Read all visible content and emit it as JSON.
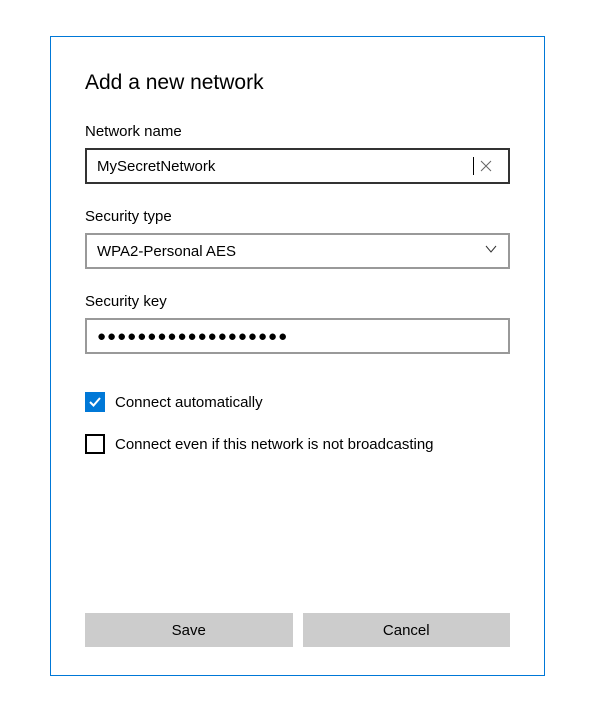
{
  "title": "Add a new network",
  "fields": {
    "network_name": {
      "label": "Network name",
      "value": "MySecretNetwork"
    },
    "security_type": {
      "label": "Security type",
      "value": "WPA2-Personal AES"
    },
    "security_key": {
      "label": "Security key",
      "value_masked": "●●●●●●●●●●●●●●●●●●●"
    }
  },
  "checkboxes": {
    "connect_auto": {
      "label": "Connect automatically",
      "checked": true
    },
    "connect_hidden": {
      "label": "Connect even if this network is not broadcasting",
      "checked": false
    }
  },
  "buttons": {
    "save": "Save",
    "cancel": "Cancel"
  }
}
